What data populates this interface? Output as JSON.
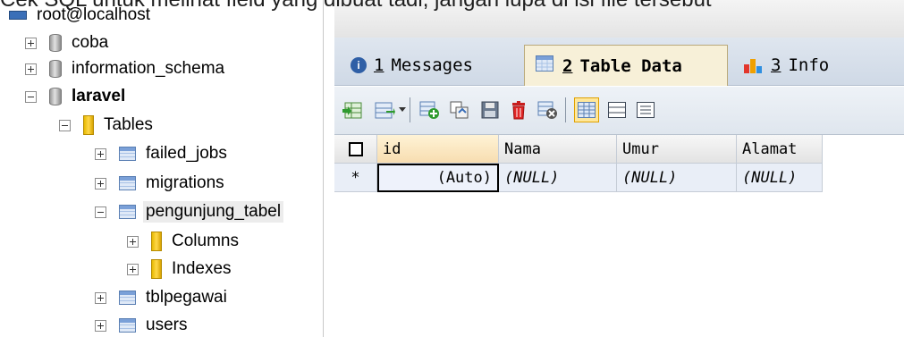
{
  "caption": {
    "text": "Cek SQL untuk melihat field yang dibuat tadi, jangan lupa di isi file tersebut"
  },
  "tree": {
    "connection_label": "root@localhost",
    "items": [
      {
        "label": "coba",
        "type": "database",
        "expanded": false
      },
      {
        "label": "information_schema",
        "type": "database",
        "expanded": false
      },
      {
        "label": "laravel",
        "type": "database",
        "expanded": true
      },
      {
        "label": "Tables",
        "type": "folder",
        "expanded": true
      },
      {
        "label": "failed_jobs",
        "type": "table",
        "expanded": false
      },
      {
        "label": "migrations",
        "type": "table",
        "expanded": false
      },
      {
        "label": "pengunjung_tabel",
        "type": "table",
        "expanded": true
      },
      {
        "label": "Columns",
        "type": "folder",
        "expanded": false
      },
      {
        "label": "Indexes",
        "type": "folder",
        "expanded": false
      },
      {
        "label": "tblpegawai",
        "type": "table",
        "expanded": false
      },
      {
        "label": "users",
        "type": "table",
        "expanded": false
      }
    ]
  },
  "tabs": [
    {
      "num": "1",
      "label": "Messages",
      "active": false
    },
    {
      "num": "2",
      "label": "Table Data",
      "active": true
    },
    {
      "num": "3",
      "label": "Info",
      "active": false
    }
  ],
  "grid": {
    "columns": [
      "id",
      "Nama",
      "Umur",
      "Alamat"
    ],
    "row_marker": "*",
    "rows": [
      [
        "(Auto)",
        "(NULL)",
        "(NULL)",
        "(NULL)"
      ]
    ]
  },
  "colors": {
    "tab_active": "#f7f0d8",
    "header_sorted": "#f7ddb0",
    "row_bg": "#e9eef7",
    "table_icon": "#7aa0d8",
    "folder_icon": "#ffd84a"
  }
}
